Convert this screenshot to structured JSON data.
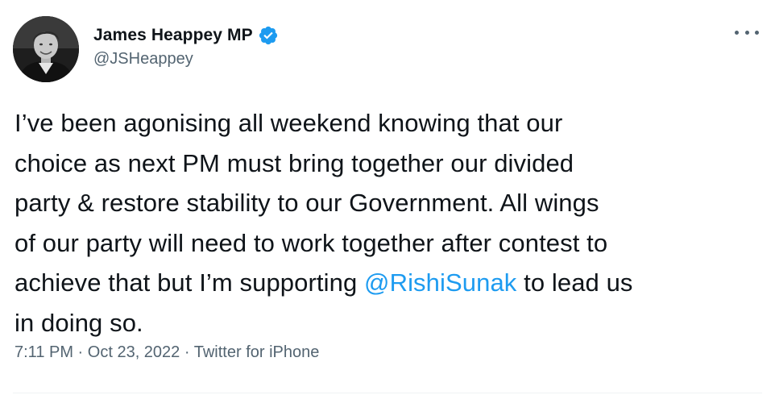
{
  "author": {
    "display_name": "James Heappey MP",
    "handle": "@JSHeappey",
    "verified": true,
    "avatar_icon": "profile-photo"
  },
  "menu": {
    "icon": "more-options-icon"
  },
  "tweet": {
    "lines": [
      "I’ve been agonising all weekend knowing that our",
      "choice as next PM must bring together our divided",
      "party & restore stability to our Government. All wings",
      "of our party will need to work together after contest to"
    ],
    "line5_before": "achieve that but I’m supporting ",
    "mention": "@RishiSunak",
    "line5_after": " to lead us",
    "line6": "in doing so."
  },
  "meta": {
    "time": "7:11 PM",
    "separator": " · ",
    "date": "Oct 23, 2022",
    "source": "Twitter for iPhone"
  },
  "colors": {
    "text": "#0f1419",
    "secondary": "#536471",
    "accent": "#1d9bf0"
  }
}
